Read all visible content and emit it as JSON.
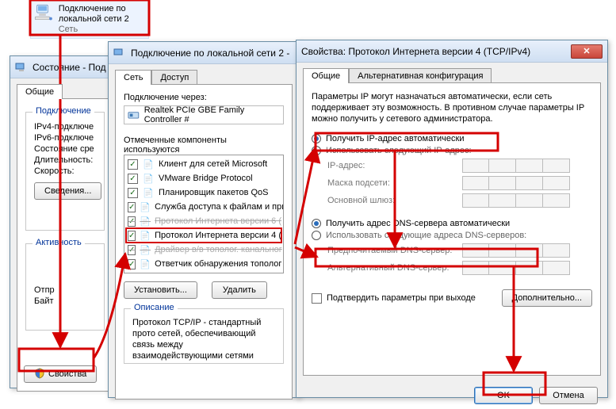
{
  "desktop": {
    "title": "Подключение по локальной сети 2",
    "subtitle": "Сеть"
  },
  "status_window": {
    "title": "Состояние - Под",
    "tab_general": "Общие",
    "group_conn": "Подключение",
    "ipv4": "IPv4-подключе",
    "ipv6": "IPv6-подключе",
    "state": "Состояние сре",
    "duration": "Длительность:",
    "speed": "Скорость:",
    "details_btn": "Сведения...",
    "group_activity": "Активность",
    "sent": "Отпр",
    "bytes": "Байт",
    "properties_btn": "Свойства"
  },
  "props_window": {
    "title": "Подключение по локальной сети 2 - ",
    "tab_net": "Сеть",
    "tab_access": "Доступ",
    "connect_via": "Подключение через:",
    "adapter": "Realtek PCIe GBE Family Controller #",
    "components_label": "Отмеченные компоненты используются",
    "components": [
      "Клиент для сетей Microsoft",
      "VMware Bridge Protocol",
      "Планировщик пакетов QoS",
      "Служба доступа к файлам и при",
      "Протокол Интернета версии 6 (",
      "Протокол Интернета версии 4 (",
      "Драйвер в/в тополог. канальног",
      "Ответчик обнаружения тополог"
    ],
    "install_btn": "Установить...",
    "remove_btn": "Удалить",
    "desc_title": "Описание",
    "desc_text": "Протокол TCP/IP - стандартный прото сетей, обеспечивающий связь между взаимодействующими сетями"
  },
  "tcpip_window": {
    "title": "Свойства: Протокол Интернета версии 4 (TCP/IPv4)",
    "tab_general": "Общие",
    "tab_alt": "Альтернативная конфигурация",
    "intro": "Параметры IP могут назначаться автоматически, если сеть поддерживает эту возможность. В противном случае параметры IP можно получить у сетевого администратора.",
    "radio_ip_auto": "Получить IP-адрес автоматически",
    "radio_ip_manual": "Использовать следующий IP-адрес:",
    "ip_label": "IP-адрес:",
    "mask_label": "Маска подсети:",
    "gw_label": "Основной шлюз:",
    "radio_dns_auto": "Получить адрес DNS-сервера автоматически",
    "radio_dns_manual": "Использовать следующие адреса DNS-серверов:",
    "dns1_label": "Предпочитаемый DNS-сервер:",
    "dns2_label": "Альтернативный DNS-сервер:",
    "confirm_exit": "Подтвердить параметры при выходе",
    "advanced_btn": "Дополнительно...",
    "ok_btn": "OK",
    "cancel_btn": "Отмена"
  }
}
